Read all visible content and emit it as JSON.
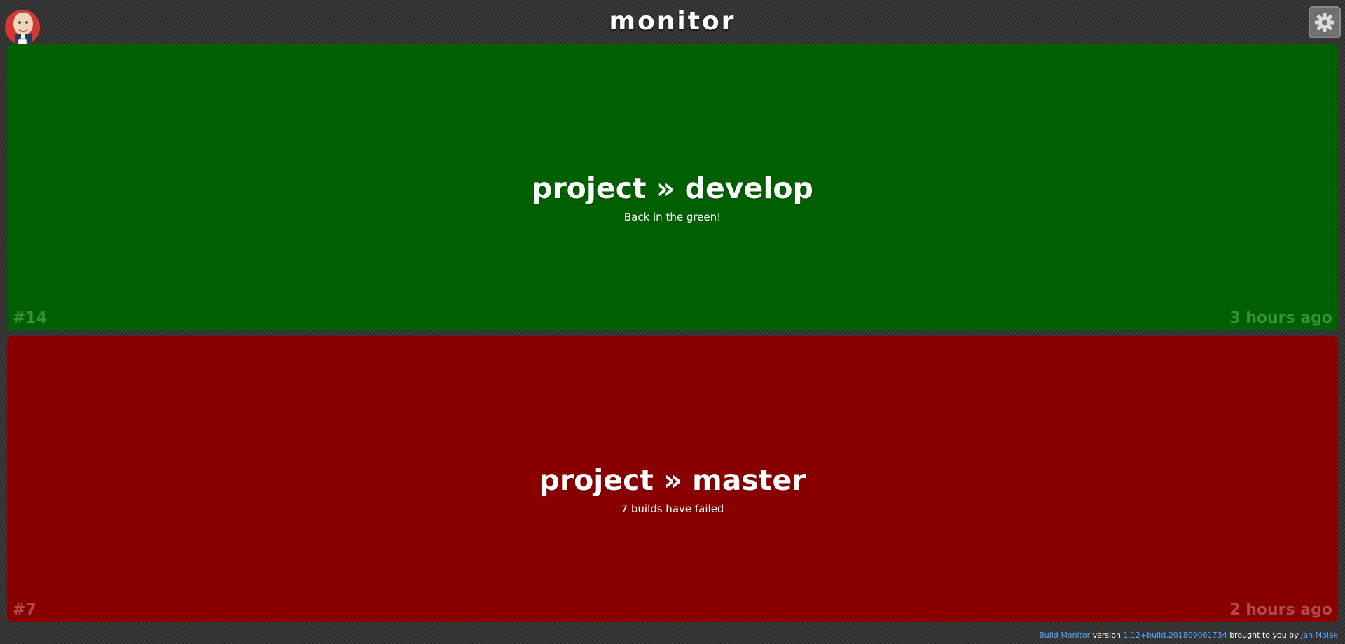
{
  "header": {
    "title": "monitor",
    "logo_icon": "jenkins-butler-logo",
    "settings_icon": "gear-icon"
  },
  "jobs": [
    {
      "name": "project » develop",
      "status": "Back in the green!",
      "build": "#14",
      "time": "3 hours ago",
      "state": "success",
      "color": "#005f00"
    },
    {
      "name": "project » master",
      "status": "7 builds have failed",
      "build": "#7",
      "time": "2 hours ago",
      "state": "failure",
      "color": "#880000"
    }
  ],
  "footer": {
    "product_link": "Build Monitor",
    "version_label": "version",
    "version_link": "1.12+build.201809061734",
    "credit_text": "brought to you by",
    "author_link": "Jan Molak"
  },
  "colors": {
    "success": "#005f00",
    "failure": "#880000",
    "link": "#5aa8ff"
  }
}
